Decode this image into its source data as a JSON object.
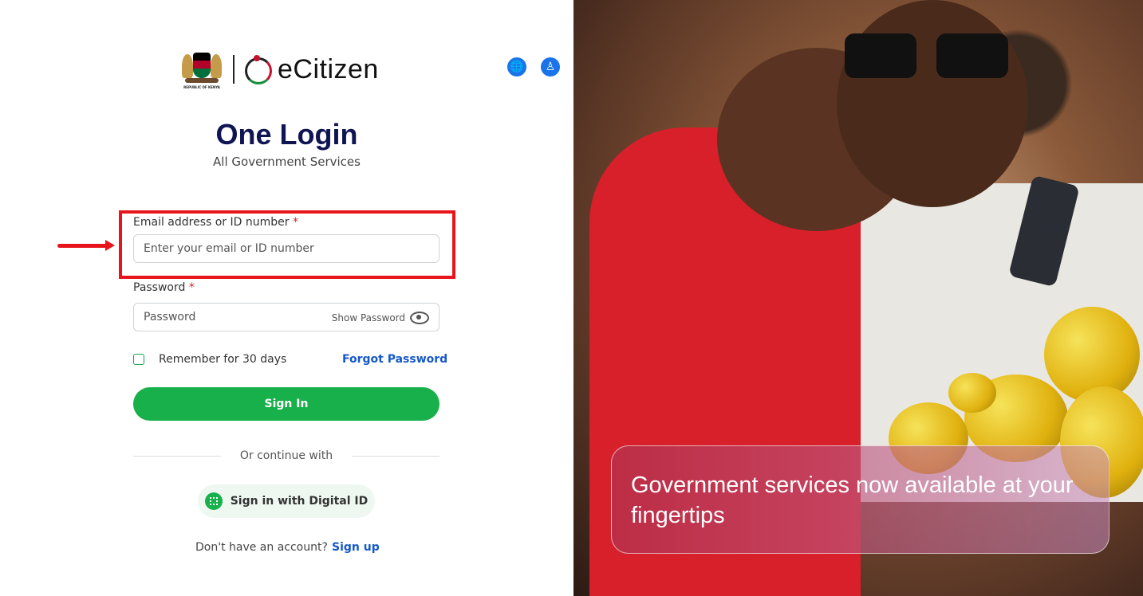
{
  "header": {
    "coat_caption": "REPUBLIC OF KENYA",
    "brand": "eCitizen",
    "translate_icon": "globe-translate-icon",
    "accessibility_icon": "accessibility-icon"
  },
  "title": "One Login",
  "subtitle": "All Government Services",
  "email": {
    "label": "Email address or ID number",
    "required": "*",
    "placeholder": "Enter your email or ID number",
    "value": ""
  },
  "password": {
    "label": "Password",
    "required": "*",
    "placeholder": "Password",
    "show_label": "Show Password"
  },
  "remember": {
    "label": "Remember for 30 days",
    "checked": false
  },
  "forgot_link": "Forgot Password",
  "signin_button": "Sign In",
  "divider_text": "Or continue with",
  "digital_id_button": "Sign in with Digital ID",
  "signup": {
    "prompt": "Don't have an account?",
    "link": "Sign up"
  },
  "hero": {
    "caption": "Government services now available at your fingertips"
  },
  "colors": {
    "primary_green": "#18b04b",
    "title_navy": "#0f1552",
    "link_blue": "#1558c9",
    "highlight_red": "#e8141b"
  }
}
